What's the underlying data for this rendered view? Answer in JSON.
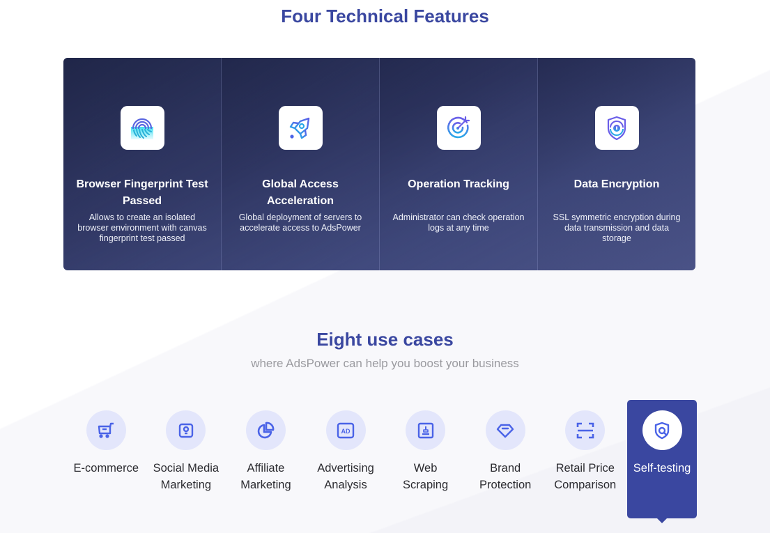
{
  "features_section": {
    "title": "Four Technical Features",
    "items": [
      {
        "icon": "fingerprint-icon",
        "title": "Browser Fingerprint Test Passed",
        "description": "Allows to create an isolated browser environment with canvas fingerprint test passed"
      },
      {
        "icon": "rocket-icon",
        "title": "Global Access Acceleration",
        "description": "Global deployment of servers to accelerate access to AdsPower"
      },
      {
        "icon": "target-icon",
        "title": "Operation Tracking",
        "description": "Administrator can check operation logs at any time"
      },
      {
        "icon": "shield-lock-icon",
        "title": "Data Encryption",
        "description": "SSL symmetric encryption during data transmission and data storage"
      }
    ]
  },
  "use_cases_section": {
    "title": "Eight use cases",
    "subtitle": "where AdsPower can help you boost your business",
    "active_index": 7,
    "items": [
      {
        "icon": "shopping-cart-icon",
        "label": "E-commerce"
      },
      {
        "icon": "social-lightbulb-icon",
        "label": "Social Media Marketing"
      },
      {
        "icon": "pie-chart-icon",
        "label": "Affiliate Marketing"
      },
      {
        "icon": "ad-icon",
        "label": "Advertising Analysis"
      },
      {
        "icon": "web-scraping-icon",
        "label": "Web Scraping"
      },
      {
        "icon": "diamond-icon",
        "label": "Brand Protection"
      },
      {
        "icon": "scan-icon",
        "label": "Retail Price Comparison"
      },
      {
        "icon": "shield-search-icon",
        "label": "Self-testing"
      }
    ]
  },
  "colors": {
    "accent": "#3a47a0",
    "icon_blue": "#4a63e7",
    "icon_circle": "#e3e6fb",
    "feature_card_bg": "#2f3662"
  }
}
